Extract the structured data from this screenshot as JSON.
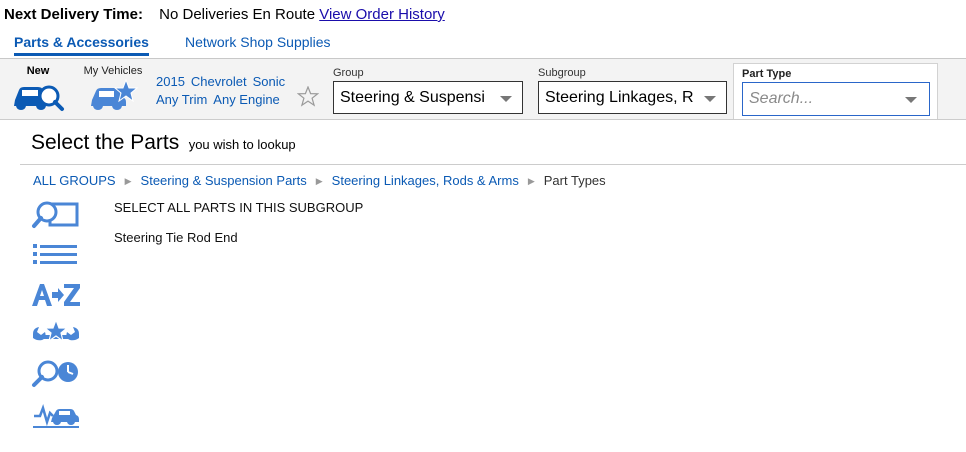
{
  "delivery": {
    "label": "Next Delivery Time:",
    "value": "No Deliveries En Route",
    "history_link": "View Order History"
  },
  "tabs": [
    {
      "label": "Parts & Accessories",
      "active": true
    },
    {
      "label": "Network Shop Supplies",
      "active": false
    }
  ],
  "toolbar": {
    "new_label": "New",
    "my_vehicles_label": "My Vehicles",
    "vehicle": {
      "year": "2015",
      "make": "Chevrolet",
      "model": "Sonic",
      "trim": "Any Trim",
      "engine": "Any Engine"
    },
    "group": {
      "caption": "Group",
      "value": "Steering & Suspensi"
    },
    "subgroup": {
      "caption": "Subgroup",
      "value": "Steering Linkages, R"
    },
    "part_type": {
      "caption": "Part Type",
      "placeholder": "Search..."
    }
  },
  "heading": {
    "main": "Select the Parts",
    "sub": "you wish to lookup"
  },
  "breadcrumb": [
    {
      "label": "ALL GROUPS"
    },
    {
      "label": "Steering & Suspension Parts"
    },
    {
      "label": "Steering Linkages, Rods & Arms"
    },
    {
      "label": "Part Types"
    }
  ],
  "side_icons": [
    "search-diagram-icon",
    "list-view-icon",
    "a-to-z-icon",
    "labor-wrench-icon",
    "search-time-icon",
    "diagnostics-car-icon"
  ],
  "parts": [
    {
      "label": "SELECT ALL PARTS IN THIS SUBGROUP"
    },
    {
      "label": "Steering Tie Rod End"
    }
  ],
  "colors": {
    "accent": "#0b5ab4",
    "icon": "#4a86d6",
    "link": "#1a0dab"
  }
}
